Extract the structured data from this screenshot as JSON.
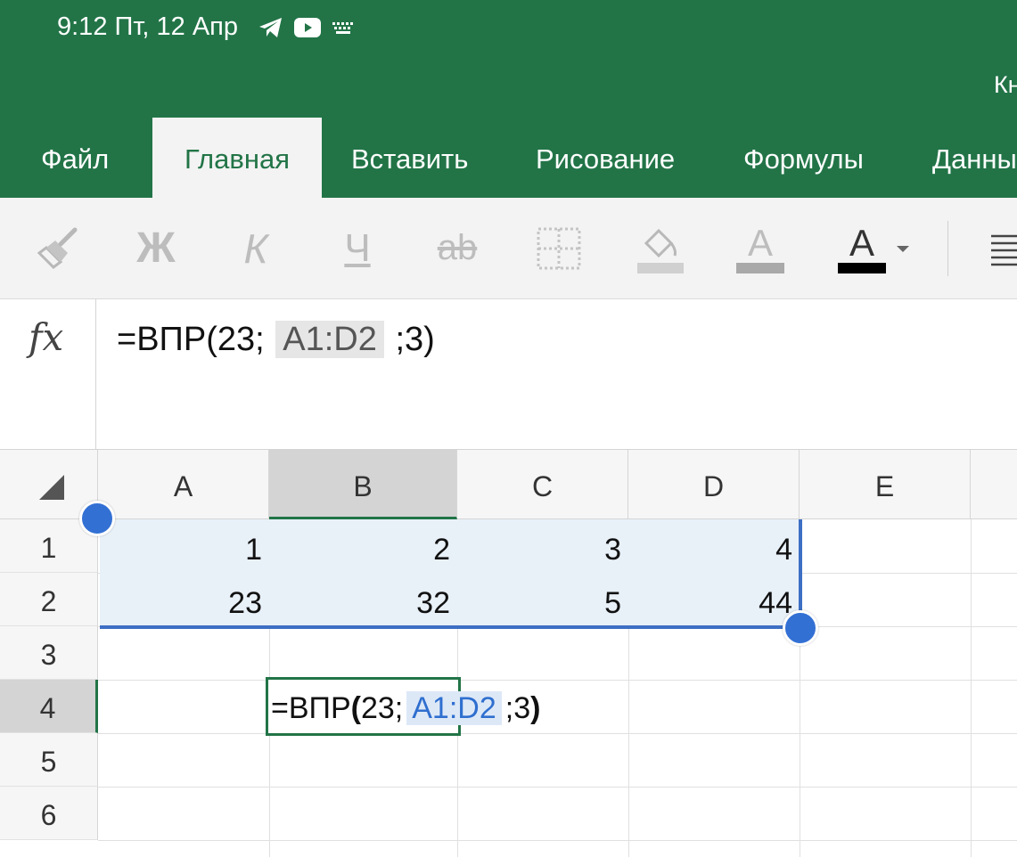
{
  "status": {
    "time": "9:12 Пт, 12 Апр",
    "icons": [
      "telegram-icon",
      "youtube-icon",
      "keyboard-icon"
    ]
  },
  "app": {
    "title": "Кн",
    "accent": "#227447",
    "selection_color": "#3d6fc4"
  },
  "tabs": [
    {
      "label": "Файл"
    },
    {
      "label": "Главная",
      "active": true
    },
    {
      "label": "Вставить"
    },
    {
      "label": "Рисование"
    },
    {
      "label": "Формулы"
    },
    {
      "label": "Данны"
    }
  ],
  "toolbar": {
    "tools": [
      "format-painter-icon",
      "bold-icon",
      "italic-icon",
      "underline-icon",
      "strikethrough-icon",
      "borders-icon",
      "fill-color-icon",
      "highlight-font-icon",
      "font-color-icon",
      "align-icon"
    ],
    "bold_glyph": "Ж",
    "italic_glyph": "К",
    "underline_glyph": "Ч",
    "strike_glyph": "ab",
    "font_color_glyph": "A",
    "highlight_glyph": "A"
  },
  "formula_bar": {
    "fx": "fx",
    "prefix": "=ВПР(23;",
    "range": "A1:D2",
    "suffix": ";3)"
  },
  "sheet": {
    "columns": [
      "A",
      "B",
      "C",
      "D",
      "E"
    ],
    "selected_column": "B",
    "rows": [
      "1",
      "2",
      "3",
      "4",
      "5",
      "6"
    ],
    "selected_row": "4",
    "cells": {
      "A1": "1",
      "B1": "2",
      "C1": "3",
      "D1": "4",
      "A2": "23",
      "B2": "32",
      "C2": "5",
      "D2": "44"
    },
    "active_cell": "B4",
    "selected_range": "A1:D2",
    "edit": {
      "prefix": "=ВПР",
      "open_paren": "(",
      "arg1": "23;",
      "range": "A1:D2",
      "arg3": ";3",
      "close_paren": ")"
    }
  }
}
